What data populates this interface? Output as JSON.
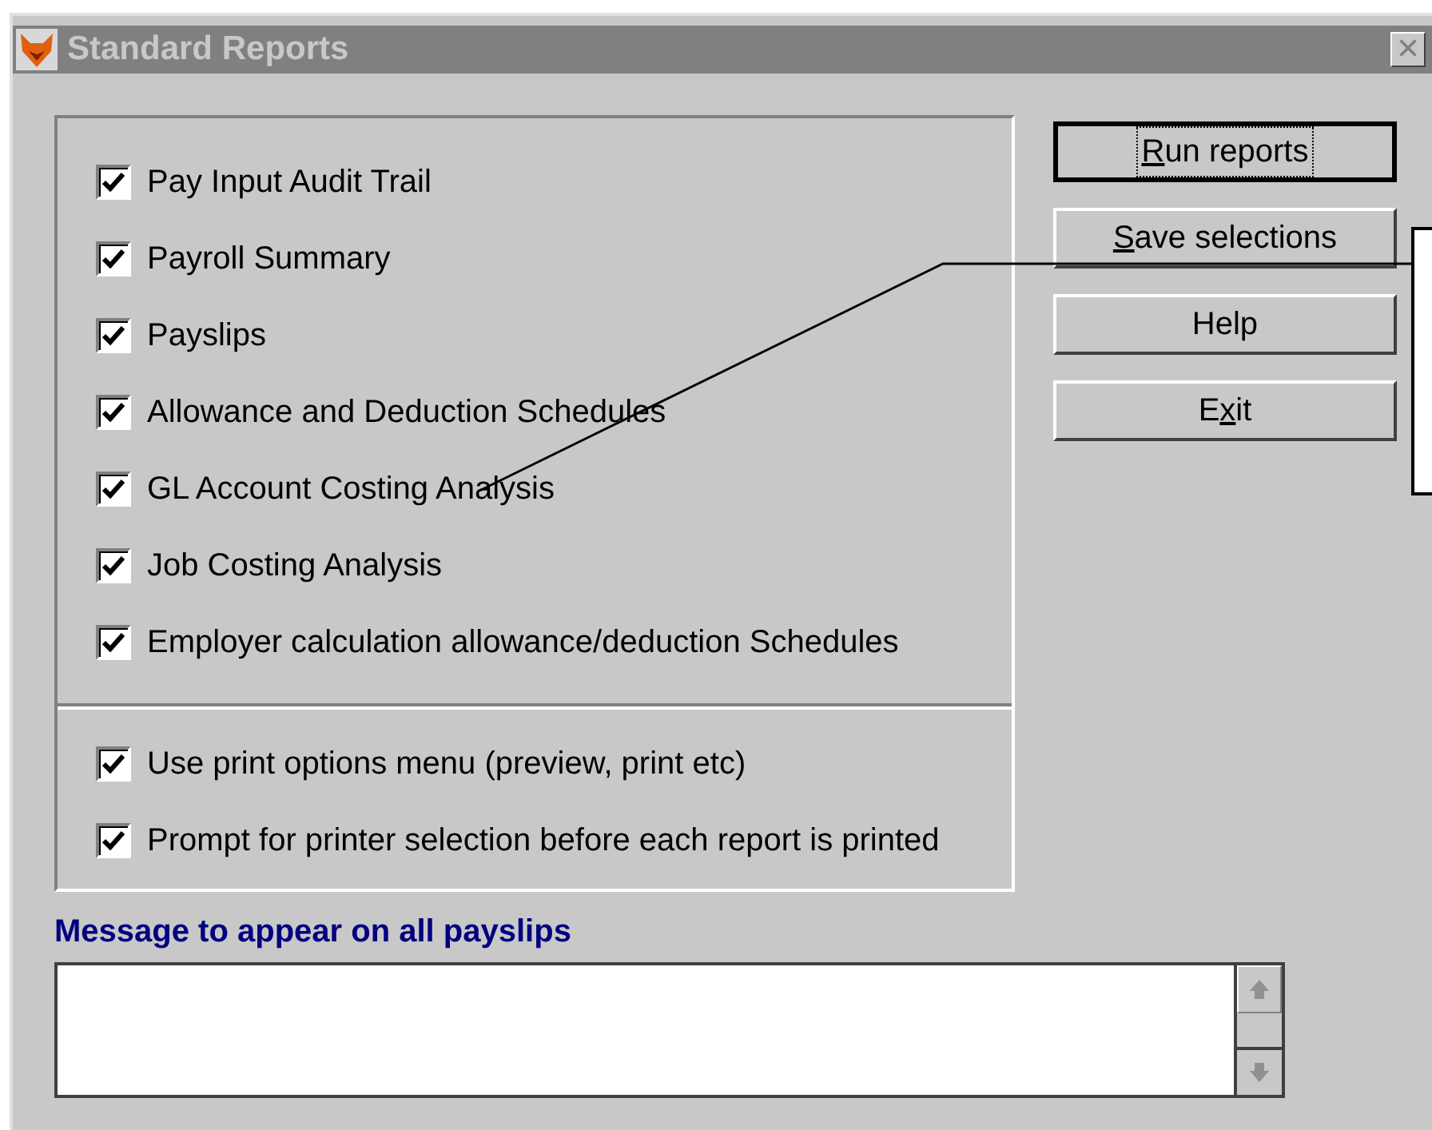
{
  "window": {
    "title": "Standard Reports",
    "close": "×"
  },
  "reports": [
    {
      "label": "Pay Input Audit Trail",
      "checked": true
    },
    {
      "label": "Payroll Summary",
      "checked": true
    },
    {
      "label": "Payslips",
      "checked": true
    },
    {
      "label": "Allowance and Deduction Schedules",
      "checked": true
    },
    {
      "label": "GL Account Costing Analysis",
      "checked": true
    },
    {
      "label": "Job Costing Analysis",
      "checked": true
    },
    {
      "label": "Employer calculation allowance/deduction Schedules",
      "checked": true
    }
  ],
  "options": [
    {
      "label": "Use print options menu (preview, print etc)",
      "checked": true
    },
    {
      "label": "Prompt for printer selection before each report is printed",
      "checked": true
    }
  ],
  "buttons": [
    {
      "key": "R",
      "post": "un reports",
      "selected": true
    },
    {
      "key": "S",
      "post": "ave selections",
      "selected": false
    },
    {
      "pre": "Help",
      "selected": false
    },
    {
      "pre": "E",
      "key": "x",
      "post": "it",
      "selected": false
    }
  ],
  "message": {
    "label": "Message to appear on all payslips"
  }
}
